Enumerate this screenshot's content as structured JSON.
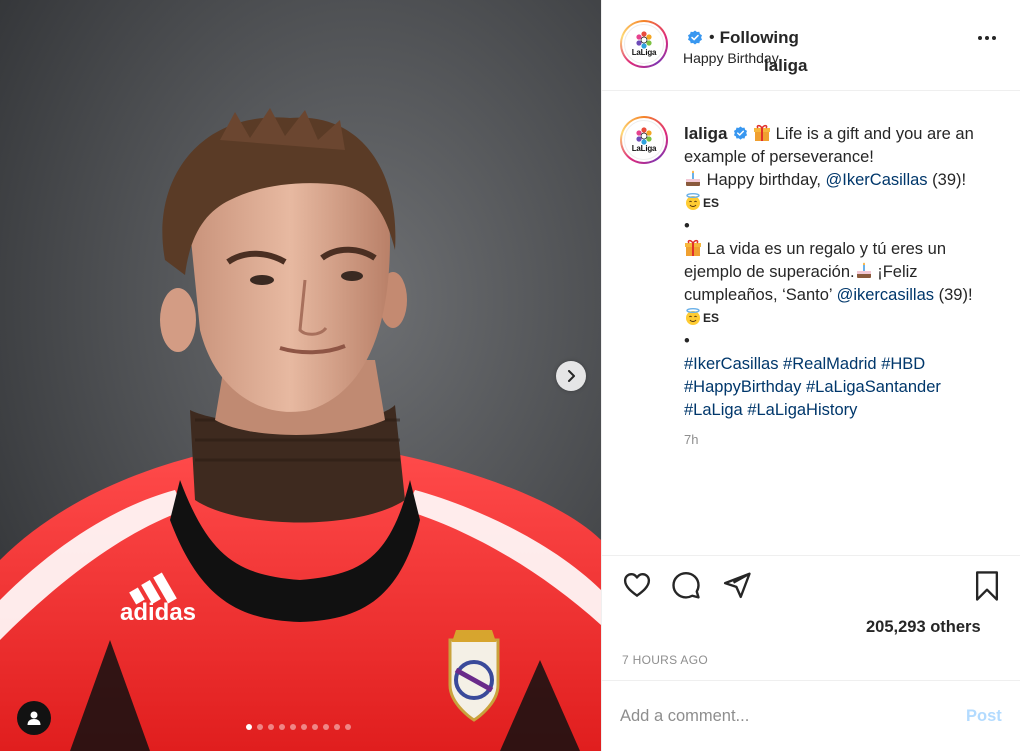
{
  "post": {
    "username": "laliga",
    "verified": true,
    "separator": "•",
    "follow_status": "Following",
    "location": "Happy Birthday",
    "avatar_logo_text": "LaLiga",
    "more_icon": "more-options-icon"
  },
  "caption": {
    "intro": "Life is a gift and you are an example of perseverance!",
    "birthday_text": "Happy birthday,",
    "mention_1": "@IkerCasillas",
    "age_1": "(39)!",
    "flag_1": "ES",
    "bullet": "•",
    "es_line_1": "La vida es un regalo y tú eres un ejemplo de superación.",
    "es_line_2": "¡Feliz cumpleaños, ‘Santo’",
    "mention_2": "@ikercasillas",
    "age_2": "(39)!",
    "flag_2": "ES",
    "hashtags": [
      "#IkerCasillas",
      "#RealMadrid",
      "#HBD",
      "#HappyBirthday",
      "#LaLigaSantander",
      "#LaLiga",
      "#LaLigaHistory"
    ],
    "time": "7h"
  },
  "engagement": {
    "likes_text": "205,293 others",
    "posted_ago": "7 HOURS AGO"
  },
  "comment": {
    "placeholder": "Add a comment...",
    "post_label": "Post"
  },
  "carousel": {
    "slide_count": 10,
    "active_index": 0
  },
  "colors": {
    "link": "#00376b",
    "muted": "#8e8e8e",
    "post_button_disabled": "#b3dbff",
    "verified_badge": "#3897f0"
  }
}
